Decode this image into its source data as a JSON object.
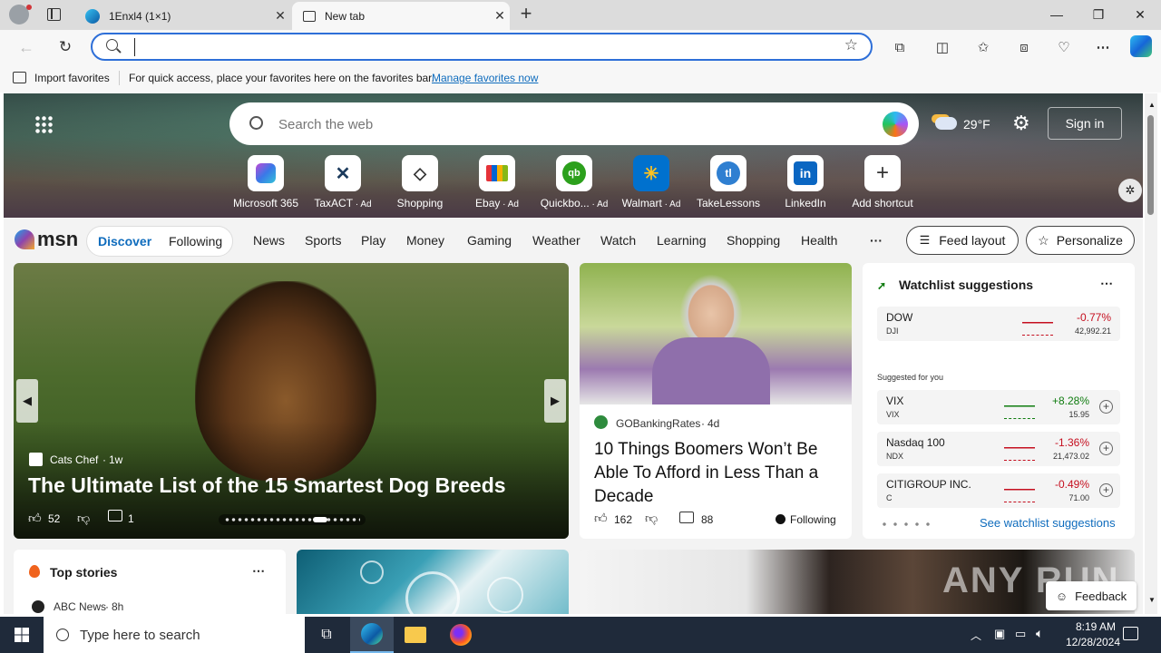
{
  "tabs": [
    {
      "title": "1Enxl4 (1×1)",
      "active": false
    },
    {
      "title": "New tab",
      "active": true
    }
  ],
  "address_bar": {
    "value": "",
    "placeholder": ""
  },
  "favorites_bar": {
    "import_label": "Import favorites",
    "message": "For quick access, place your favorites here on the favorites bar.",
    "manage_link": "Manage favorites now"
  },
  "hero": {
    "search_placeholder": "Search the web",
    "weather_temp": "29°F",
    "sign_in": "Sign in",
    "shortcuts": [
      {
        "label": "Microsoft 365",
        "ad": ""
      },
      {
        "label": "TaxACT",
        "ad": "Ad"
      },
      {
        "label": "Shopping",
        "ad": ""
      },
      {
        "label": "Ebay",
        "ad": "Ad"
      },
      {
        "label": "Quickbo...",
        "ad": "Ad"
      },
      {
        "label": "Walmart",
        "ad": "Ad"
      },
      {
        "label": "TakeLessons",
        "ad": ""
      },
      {
        "label": "LinkedIn",
        "ad": ""
      },
      {
        "label": "Add shortcut",
        "ad": ""
      }
    ]
  },
  "msn": {
    "logo": "msn",
    "segment": [
      "Discover",
      "Following"
    ],
    "nav": [
      "News",
      "Sports",
      "Play",
      "Money",
      "Gaming",
      "Weather",
      "Watch",
      "Learning",
      "Shopping",
      "Health"
    ],
    "more": "···",
    "feed_layout": "Feed layout",
    "personalize": "Personalize"
  },
  "main_story": {
    "source": "Cats Chef",
    "age": "1w",
    "title": "The Ultimate List of the 15 Smartest Dog Breeds",
    "likes": "52",
    "comments": "1"
  },
  "side_story": {
    "source": "GOBankingRates",
    "age": "4d",
    "title": "10 Things Boomers Won’t Be Able To Afford in Less Than a Decade",
    "likes": "162",
    "comments": "88",
    "following": "Following"
  },
  "watchlist": {
    "title": "Watchlist suggestions",
    "suggested_label": "Suggested for you",
    "see_more": "See watchlist suggestions",
    "top": {
      "name": "DOW",
      "symbol": "DJI",
      "change": "-0.77%",
      "value": "42,992.21"
    },
    "items": [
      {
        "name": "VIX",
        "symbol": "VIX",
        "change": "+8.28%",
        "value": "15.95",
        "up": true
      },
      {
        "name": "Nasdaq 100",
        "symbol": "NDX",
        "change": "-1.36%",
        "value": "21,473.02",
        "up": false
      },
      {
        "name": "CITIGROUP INC.",
        "symbol": "C",
        "change": "-0.49%",
        "value": "71.00",
        "up": false
      }
    ]
  },
  "top_stories": {
    "title": "Top stories",
    "first_source": "ABC News",
    "first_age": "8h"
  },
  "feedback": "Feedback",
  "watermark": "ANY RUN",
  "taskbar": {
    "search_placeholder": "Type here to search",
    "time": "8:19 AM",
    "date": "12/28/2024"
  },
  "colors": {
    "accent": "#0f6cbd",
    "up": "#107c10",
    "down": "#c50f1f",
    "taskbar": "#1f2a3a"
  }
}
